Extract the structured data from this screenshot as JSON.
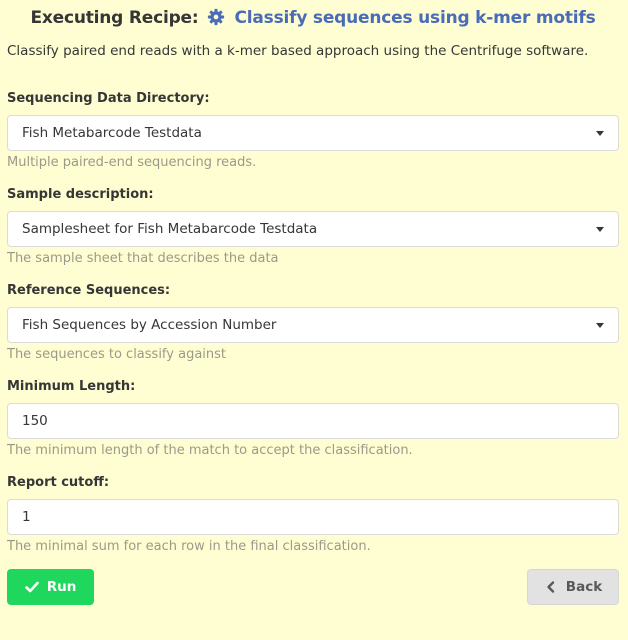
{
  "header": {
    "prefix": "Executing Recipe:",
    "icon": "gear-icon",
    "recipe_title": "Classify sequences using k-mer motifs"
  },
  "description": "Classify paired end reads with a k-mer based approach using the Centrifuge software.",
  "fields": [
    {
      "label": "Sequencing Data Directory:",
      "type": "select",
      "value": "Fish Metabarcode Testdata",
      "help": "Multiple paired-end sequencing reads."
    },
    {
      "label": "Sample description:",
      "type": "select",
      "value": "Samplesheet for Fish Metabarcode Testdata",
      "help": "The sample sheet that describes the data"
    },
    {
      "label": "Reference Sequences:",
      "type": "select",
      "value": "Fish Sequences by Accession Number",
      "help": "The sequences to classify against"
    },
    {
      "label": "Minimum Length:",
      "type": "input",
      "value": "150",
      "help": "The minimum length of the match to accept the classification."
    },
    {
      "label": "Report cutoff:",
      "type": "input",
      "value": "1",
      "help": "The minimal sum for each row in the final classification."
    }
  ],
  "buttons": {
    "run_label": "Run",
    "run_icon": "check-icon",
    "back_label": "Back",
    "back_icon": "chevron-left-icon"
  },
  "colors": {
    "background": "#fefed2",
    "accent": "#4a6cb8",
    "run": "#1ed75c",
    "back": "#e2e2e2"
  }
}
